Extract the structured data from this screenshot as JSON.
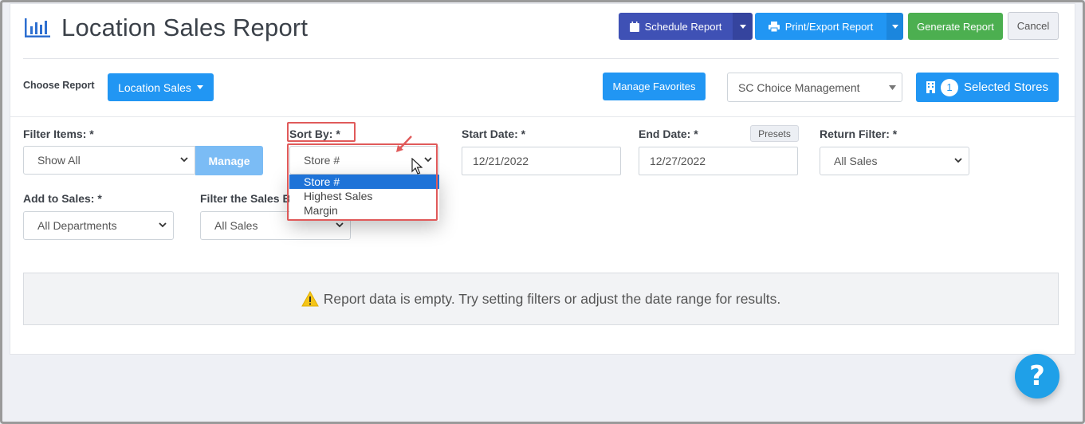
{
  "header": {
    "title": "Location Sales Report",
    "schedule_label": "Schedule Report",
    "print_label": "Print/Export Report",
    "generate_label": "Generate Report",
    "cancel_label": "Cancel"
  },
  "toolbar": {
    "choose_report_label": "Choose Report",
    "report_select_label": "Location Sales",
    "manage_favorites_label": "Manage Favorites",
    "company_select_value": "SC Choice Management",
    "selected_stores_count": "1",
    "selected_stores_label": "Selected Stores"
  },
  "filters": {
    "filter_items_label": "Filter Items: *",
    "filter_items_value": "Show All",
    "manage_label": "Manage",
    "sort_by_label": "Sort By: *",
    "sort_by_value": "Store #",
    "sort_options": [
      "Store #",
      "Highest Sales",
      "Margin"
    ],
    "start_date_label": "Start Date: *",
    "start_date_value": "12/21/2022",
    "end_date_label": "End Date: *",
    "end_date_value": "12/27/2022",
    "presets_label": "Presets",
    "return_filter_label": "Return Filter: *",
    "return_filter_value": "All Sales",
    "add_to_sales_label": "Add to Sales: *",
    "add_to_sales_value": "All Departments",
    "filter_sales_label": "Filter the Sales B",
    "filter_sales_value": "All Sales"
  },
  "empty_message": "Report data is empty. Try setting filters or adjust the date range for results.",
  "help_label": "?",
  "colors": {
    "indigo": "#3f51b5",
    "blue": "#2196f3",
    "green": "#4caf50",
    "highlight": "#1e73d8",
    "annotation_red": "#e05a5a",
    "warning": "#f5c518"
  }
}
